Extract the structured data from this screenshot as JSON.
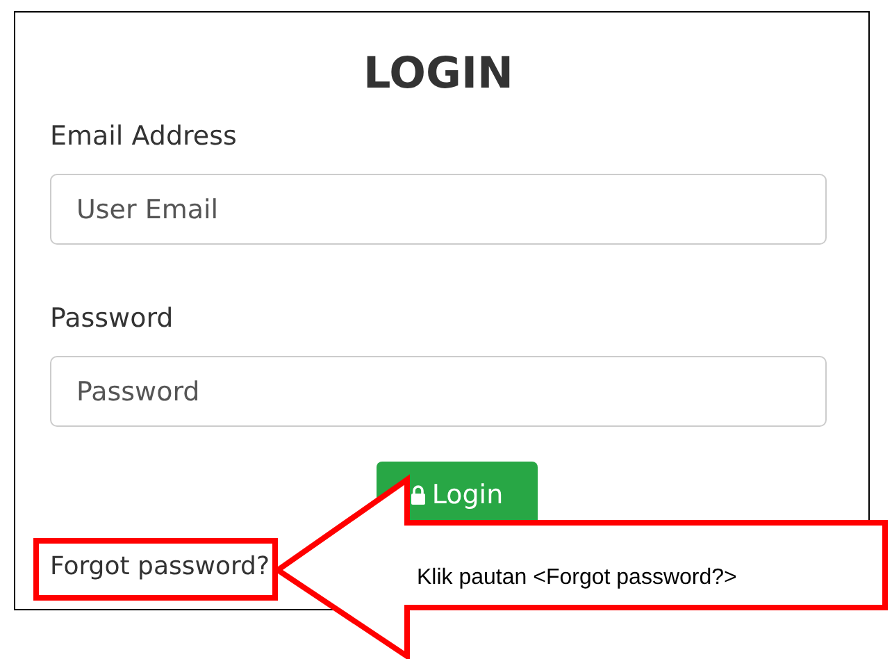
{
  "title": "LOGIN",
  "fields": [
    {
      "label": "Email Address",
      "placeholder": "User Email"
    },
    {
      "label": "Password",
      "placeholder": "Password"
    }
  ],
  "login_button": "Login",
  "forgot_link": "Forgot password?",
  "callout": {
    "text": "Klik pautan <Forgot password?>"
  }
}
